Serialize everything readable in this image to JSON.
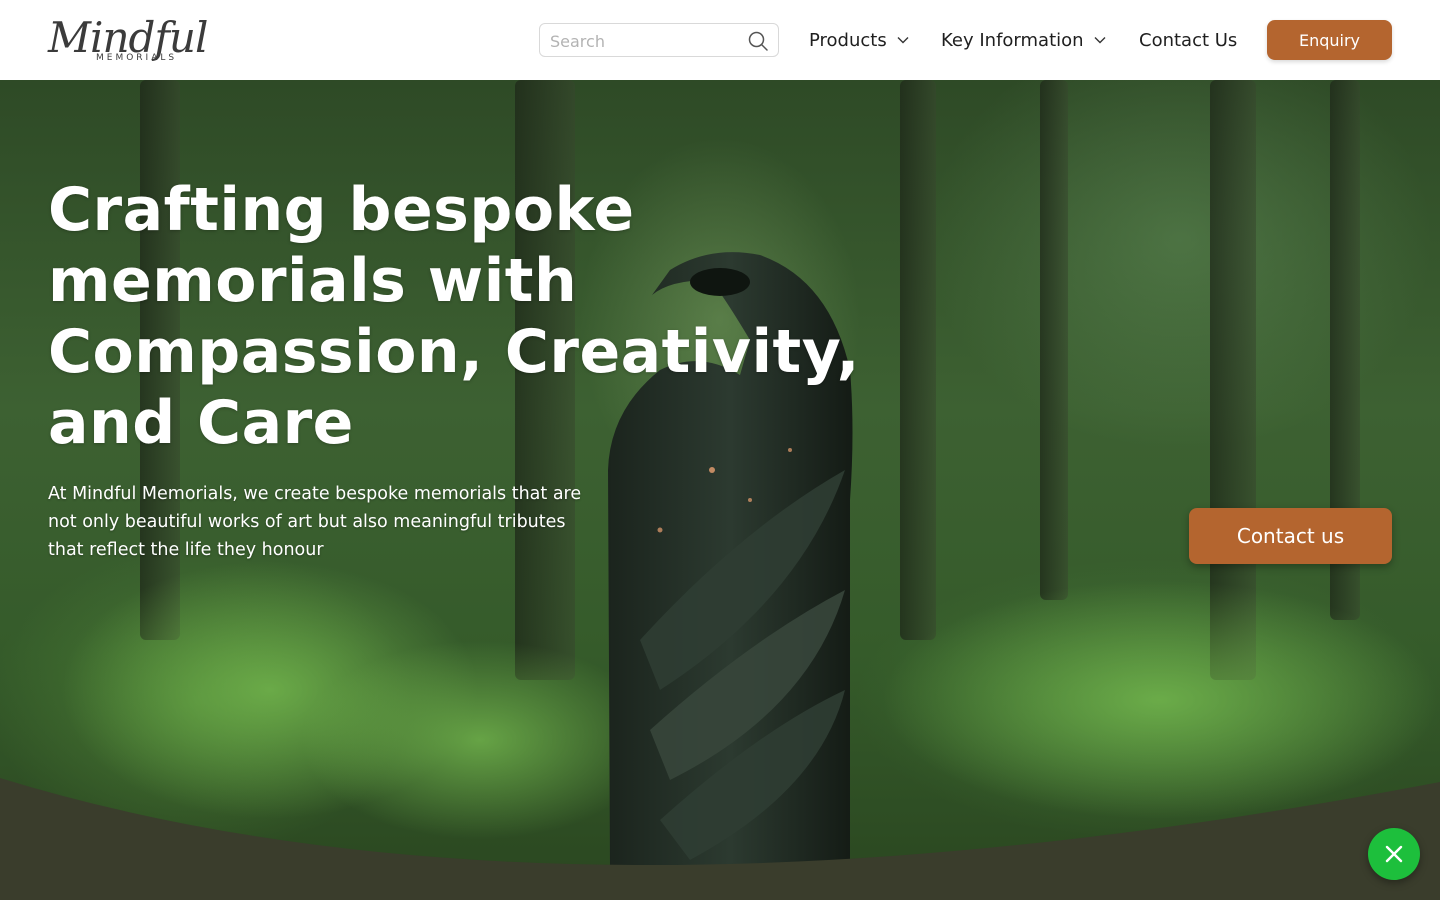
{
  "brand": {
    "logo_script": "Mindful",
    "logo_sub": "MEMORIALS"
  },
  "header": {
    "search": {
      "placeholder": "Search",
      "value": "",
      "icon": "search-icon"
    },
    "nav": [
      {
        "label": "Products",
        "has_dropdown": true
      },
      {
        "label": "Key Information",
        "has_dropdown": true
      },
      {
        "label": "Contact Us",
        "has_dropdown": false
      }
    ],
    "enquiry_label": "Enquiry"
  },
  "hero": {
    "title": "Crafting bespoke memorials with Compassion, Creativity, and Care",
    "description": "At Mindful Memorials, we create bespoke memorials that are not only beautiful works of art but also meaningful tributes that reflect the life they honour",
    "cta_label": "Contact us"
  },
  "colors": {
    "accent": "#b4652f",
    "footer_band": "#3a3d2c",
    "fab": "#1dbf3c",
    "text_dark": "#1f1f1f"
  },
  "fab": {
    "icon": "close-icon"
  }
}
